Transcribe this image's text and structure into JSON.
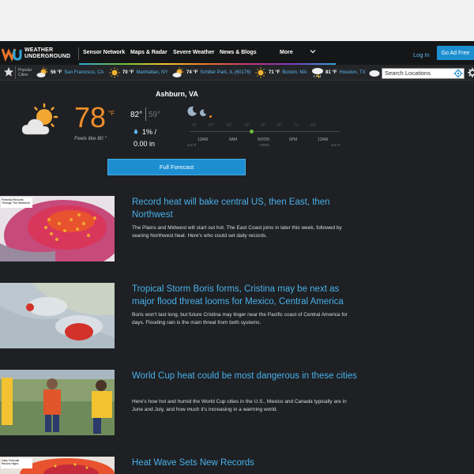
{
  "nav": {
    "logo_line1": "WEATHER",
    "logo_line2": "UNDERGROUND",
    "items": [
      "Sensor Network",
      "Maps & Radar",
      "Severe Weather",
      "News & Blogs",
      "More"
    ],
    "login": "Log In",
    "ad_free": "Go Ad Free"
  },
  "cities_bar": {
    "popular_label_1": "Popular",
    "popular_label_2": "Cities",
    "cities": [
      {
        "temp": "56 °F",
        "name": "San Francisco, CA",
        "icon": "partly-cloudy-sun-icon"
      },
      {
        "temp": "70 °F",
        "name": "Manhattan, NY",
        "icon": "sun-icon"
      },
      {
        "temp": "74 °F",
        "name": "Schiller Park, IL (60176)",
        "icon": "partly-cloudy-sun-icon"
      },
      {
        "temp": "71 °F",
        "name": "Boston, MA",
        "icon": "sun-icon"
      },
      {
        "temp": "81 °F",
        "name": "Houston, TX",
        "icon": "thunderstorm-icon"
      }
    ],
    "search_placeholder": "Search Locations"
  },
  "current": {
    "location": "Ashburn, VA",
    "temp": "78",
    "unit": "°F",
    "feels_like": "Feels like 80 °",
    "high": "82°",
    "low": "59°",
    "precip_pct": "1% /",
    "precip_in": "0.00 in",
    "icon": "partly-cloudy-sun-icon"
  },
  "hourly": {
    "temps": [
      "73°",
      "67°",
      "62°",
      "72°",
      "78°",
      "79°",
      "71°",
      "63°"
    ],
    "labels": [
      "12AM",
      "6AM",
      "NOON",
      "6PM",
      "12AM"
    ],
    "sub_left": "Jun 8",
    "sub_mid": "+0000",
    "sub_right": "Jun 9"
  },
  "full_forecast_label": "Full Forecast",
  "articles": [
    {
      "title": "Record heat will bake central US, then East, then Northwest",
      "body": "The Plains and Midwest will start out hot. The East Coast joins in later this week, followed by searing Northwest heat. Here's who could set daily records.",
      "thumb_label_1": "Potential Records",
      "thumb_label_2": "Through The Weekend"
    },
    {
      "title": "Tropical Storm Boris forms, Cristina may be next as major flood threat looms for Mexico, Central America",
      "body": "Boris won't last long, but future Cristina may linger near the Pacific coast of Central America for days. Flooding rain is the main threat from both systems."
    },
    {
      "title": "World Cup heat could be most dangerous in these cities",
      "body": "Here's how hot and humid the World Cup cities in the U.S., Mexico and Canada typically are in June and July, and how much it's increasing in a warming world."
    },
    {
      "title": "Heat Wave Sets New Records",
      "body": "",
      "thumb_label_1": "Daily Forecast",
      "thumb_label_2": "Record Highs"
    }
  ]
}
